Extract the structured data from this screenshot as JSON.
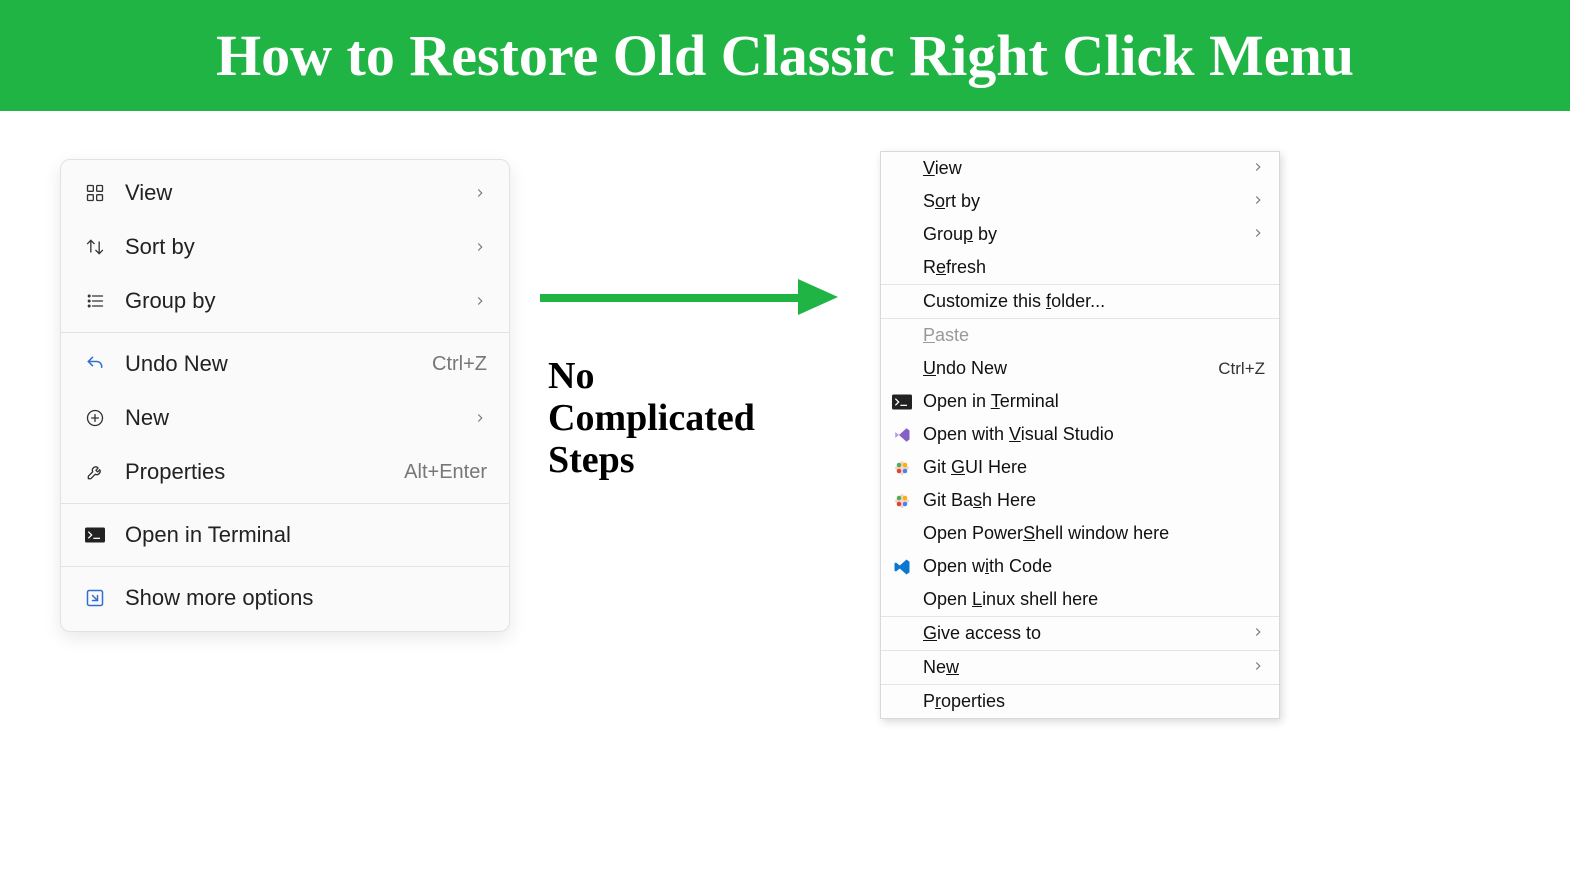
{
  "header": {
    "title": "How to Restore Old Classic Right Click Menu"
  },
  "caption": "No\nComplicated\nSteps",
  "win11_menu": {
    "items": [
      {
        "icon": "grid-icon",
        "label": "View",
        "shortcut": "",
        "submenu": true
      },
      {
        "icon": "sort-icon",
        "label": "Sort by",
        "shortcut": "",
        "submenu": true
      },
      {
        "icon": "group-icon",
        "label": "Group by",
        "shortcut": "",
        "submenu": true
      },
      {
        "icon": "undo-icon",
        "label": "Undo New",
        "shortcut": "Ctrl+Z",
        "submenu": false
      },
      {
        "icon": "new-icon",
        "label": "New",
        "shortcut": "",
        "submenu": true
      },
      {
        "icon": "wrench-icon",
        "label": "Properties",
        "shortcut": "Alt+Enter",
        "submenu": false
      },
      {
        "icon": "terminal-icon",
        "label": "Open in Terminal",
        "shortcut": "",
        "submenu": false
      },
      {
        "icon": "expand-icon",
        "label": "Show more options",
        "shortcut": "",
        "submenu": false
      }
    ],
    "separators_after": [
      2,
      5,
      6
    ]
  },
  "classic_menu": {
    "items": [
      {
        "icon": "",
        "label_html": "<span class='u'>V</span>iew",
        "shortcut": "",
        "submenu": true,
        "disabled": false
      },
      {
        "icon": "",
        "label_html": "S<span class='u'>o</span>rt by",
        "shortcut": "",
        "submenu": true,
        "disabled": false
      },
      {
        "icon": "",
        "label_html": "Grou<span class='u'>p</span> by",
        "shortcut": "",
        "submenu": true,
        "disabled": false
      },
      {
        "icon": "",
        "label_html": "R<span class='u'>e</span>fresh",
        "shortcut": "",
        "submenu": false,
        "disabled": false
      },
      {
        "sep": true
      },
      {
        "icon": "",
        "label_html": "Customize this <span class='u'>f</span>older...",
        "shortcut": "",
        "submenu": false,
        "disabled": false
      },
      {
        "sep": true
      },
      {
        "icon": "",
        "label_html": "<span class='u'>P</span>aste",
        "shortcut": "",
        "submenu": false,
        "disabled": true
      },
      {
        "icon": "",
        "label_html": "<span class='u'>U</span>ndo New",
        "shortcut": "Ctrl+Z",
        "submenu": false,
        "disabled": false
      },
      {
        "icon": "terminal-icon",
        "label_html": "Open in <span class='u'>T</span>erminal",
        "shortcut": "",
        "submenu": false,
        "disabled": false
      },
      {
        "icon": "vs-icon",
        "label_html": "Open with <span class='u'>V</span>isual Studio",
        "shortcut": "",
        "submenu": false,
        "disabled": false
      },
      {
        "icon": "git-icon",
        "label_html": "Git <span class='u'>G</span>UI Here",
        "shortcut": "",
        "submenu": false,
        "disabled": false
      },
      {
        "icon": "git-icon",
        "label_html": "Git Ba<span class='u'>s</span>h Here",
        "shortcut": "",
        "submenu": false,
        "disabled": false
      },
      {
        "icon": "",
        "label_html": "Open Power<span class='u'>S</span>hell window here",
        "shortcut": "",
        "submenu": false,
        "disabled": false
      },
      {
        "icon": "vscode-icon",
        "label_html": "Open w<span class='u'>i</span>th Code",
        "shortcut": "",
        "submenu": false,
        "disabled": false
      },
      {
        "icon": "",
        "label_html": "Open <span class='u'>L</span>inux shell here",
        "shortcut": "",
        "submenu": false,
        "disabled": false
      },
      {
        "sep": true
      },
      {
        "icon": "",
        "label_html": "<span class='u'>G</span>ive access to",
        "shortcut": "",
        "submenu": true,
        "disabled": false
      },
      {
        "sep": true
      },
      {
        "icon": "",
        "label_html": "Ne<span class='u'>w</span>",
        "shortcut": "",
        "submenu": true,
        "disabled": false
      },
      {
        "sep": true
      },
      {
        "icon": "",
        "label_html": "P<span class='u'>r</span>operties",
        "shortcut": "",
        "submenu": false,
        "disabled": false
      }
    ]
  }
}
